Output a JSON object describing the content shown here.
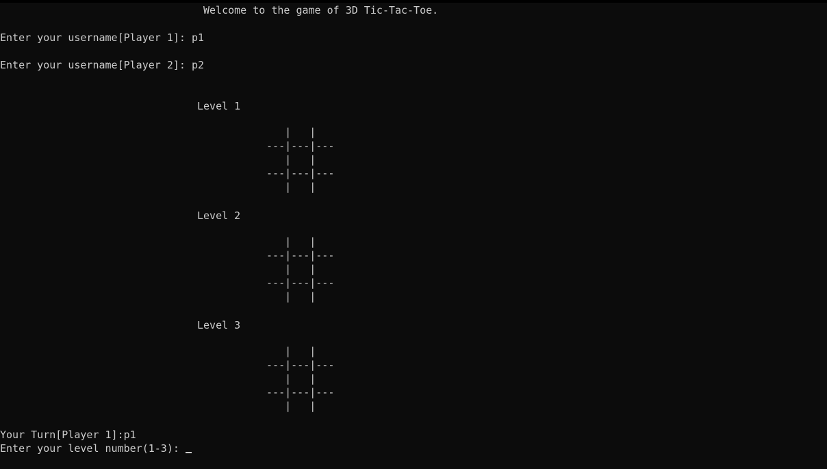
{
  "terminal": {
    "title": "Welcome to the game of 3D Tic-Tac-Toe.",
    "player1_prompt": "Enter your username[Player 1]: p1",
    "player2_prompt": "Enter your username[Player 2]: p2",
    "levels": [
      {
        "label": "Level 1",
        "board": "    |   |\n ---|---|---\n    |   |\n ---|---|---\n    |   |"
      },
      {
        "label": "Level 2",
        "board": "    |   |\n ---|---|---\n    |   |\n ---|---|---\n    |   |"
      },
      {
        "label": "Level 3",
        "board": "    |   |\n ---|---|---\n    |   |\n ---|---|---\n    |   |"
      }
    ],
    "turn_text": "Your Turn[Player 1]:p1",
    "level_prompt": "Enter your level number(1-3): "
  }
}
